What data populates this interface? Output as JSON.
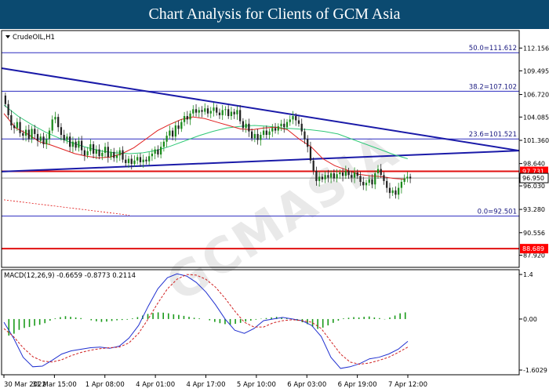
{
  "header": {
    "title": "Chart Analysis for Clients of GCM Asia"
  },
  "watermark": "GCMASIA",
  "chart_data": [
    {
      "type": "candlestick",
      "symbol_label": "CrudeOIL,H1",
      "x_ticks": [
        "30 Mar 2022",
        "31 Mar 15:00",
        "1 Apr 08:00",
        "4 Apr 01:00",
        "4 Apr 17:00",
        "5 Apr 10:00",
        "6 Apr 03:00",
        "6 Apr 19:00",
        "7 Apr 12:00"
      ],
      "y_ticks": [
        "112.156",
        "109.495",
        "106.720",
        "104.085",
        "101.360",
        "98.640",
        "96.030",
        "93.280",
        "90.556",
        "87.920"
      ],
      "ylim": [
        86.5,
        114.2
      ],
      "grid": false,
      "fib_levels": [
        {
          "label": "50.0=111.612",
          "value": 111.612
        },
        {
          "label": "38.2=107.102",
          "value": 107.102
        },
        {
          "label": "23.6=101.521",
          "value": 101.521
        },
        {
          "label": "0.0=92.501",
          "value": 92.501
        }
      ],
      "price_tags": [
        {
          "label": "97.731",
          "value": 97.731,
          "color": "#ff0000"
        },
        {
          "label": "96.950",
          "value": 96.95,
          "color": "#000000"
        },
        {
          "label": "88.689",
          "value": 88.689,
          "color": "#ff0000"
        }
      ],
      "horizontal_red_lines": [
        97.731,
        88.689
      ],
      "trendlines": [
        {
          "name": "descending resistance",
          "from": [
            0,
            109.8
          ],
          "to": [
            165,
            100.15
          ]
        },
        {
          "name": "ascending support",
          "from": [
            0,
            97.7
          ],
          "to": [
            165,
            100.15
          ]
        }
      ],
      "close": [
        105.6,
        104.3,
        103.1,
        102.8,
        103.5,
        102.2,
        101.9,
        102.6,
        101.5,
        102.7,
        102.1,
        101.3,
        101.8,
        100.9,
        101.5,
        102.5,
        103.8,
        104.1,
        102.9,
        102.0,
        101.4,
        101.8,
        100.6,
        101.2,
        100.5,
        101.3,
        100.2,
        99.6,
        100.1,
        100.9,
        99.8,
        100.3,
        99.5,
        99.9,
        100.6,
        99.4,
        100.0,
        99.3,
        99.6,
        100.2,
        99.1,
        98.7,
        99.2,
        98.6,
        99.0,
        99.4,
        98.8,
        99.1,
        98.9,
        99.5,
        99.8,
        100.3,
        99.7,
        100.6,
        101.2,
        101.9,
        102.5,
        101.8,
        103.1,
        102.7,
        103.5,
        104.2,
        103.8,
        104.5,
        105.0,
        104.6,
        104.9,
        104.7,
        105.1,
        104.5,
        104.8,
        105.2,
        104.6,
        104.3,
        104.9,
        105.0,
        104.2,
        104.7,
        104.4,
        104.9,
        103.6,
        102.8,
        103.3,
        102.4,
        101.6,
        102.1,
        101.4,
        102.0,
        102.5,
        102.0,
        102.4,
        102.8,
        102.5,
        103.0,
        103.3,
        102.9,
        103.5,
        103.8,
        104.2,
        103.7,
        103.3,
        102.4,
        101.5,
        100.6,
        99.0,
        97.8,
        96.6,
        97.1,
        96.8,
        97.3,
        97.0,
        97.5,
        96.9,
        97.4,
        97.6,
        97.2,
        97.8,
        97.3,
        97.0,
        97.6,
        97.2,
        96.5,
        96.1,
        96.4,
        96.8,
        96.2,
        97.5,
        98.0,
        97.3,
        96.6,
        95.8,
        95.2,
        95.5,
        95.0,
        95.8,
        96.5,
        96.9,
        97.1,
        96.9
      ],
      "ma_red_values": [
        104.5,
        102.8,
        102.1,
        101.2,
        100.8,
        100.3,
        99.8,
        99.5,
        99.3,
        99.4,
        99.8,
        100.5,
        101.5,
        102.5,
        103.2,
        103.8,
        104.1,
        103.9,
        103.5,
        103.1,
        102.7,
        102.6,
        102.8,
        102.9,
        102.6,
        101.5,
        100.6,
        99.2,
        98.4,
        97.9,
        97.4,
        97.2,
        97.1,
        96.9,
        96.8
      ],
      "ma_green_values": [
        105.5,
        104.2,
        103.2,
        102.3,
        101.6,
        101.0,
        100.5,
        100.1,
        99.9,
        99.8,
        99.9,
        100.2,
        100.7,
        101.3,
        101.9,
        102.4,
        102.8,
        103.0,
        103.1,
        103.0,
        102.8,
        102.7,
        102.6,
        102.4,
        102.1,
        101.5,
        100.9,
        100.3,
        99.7,
        99.2
      ],
      "ma_colors": {
        "red": "#e02020",
        "green": "#30c878"
      },
      "trendline_color": "#1a1aa8",
      "fib_color": "#2b2bc0",
      "candle_up_color": "#1a8a1a",
      "candle_down_color": "#222222"
    },
    {
      "type": "macd",
      "indicator_label": "MACD(12,26,9) -0.6659 -0.8773 0.2114",
      "y_ticks": [
        "1.4",
        "0.00",
        "-1.6029"
      ],
      "ylim": [
        -1.75,
        1.55
      ],
      "histogram": [
        -0.52,
        -0.46,
        -0.34,
        -0.28,
        -0.25,
        -0.21,
        -0.18,
        -0.13,
        -0.05,
        0.02,
        0.06,
        0.09,
        0.07,
        0.05,
        0.03,
        0.0,
        -0.04,
        -0.07,
        -0.09,
        -0.08,
        -0.06,
        -0.04,
        -0.03,
        -0.02,
        0.02,
        0.06,
        0.11,
        0.16,
        0.19,
        0.21,
        0.2,
        0.18,
        0.15,
        0.13,
        0.1,
        0.07,
        0.04,
        0.02,
        0.0,
        -0.04,
        -0.09,
        -0.13,
        -0.16,
        -0.18,
        -0.15,
        -0.12,
        -0.08,
        -0.05,
        -0.02,
        0.01,
        0.03,
        0.05,
        0.07,
        0.06,
        0.03,
        -0.01,
        -0.05,
        -0.1,
        -0.16,
        -0.24,
        -0.31,
        -0.27,
        -0.2,
        -0.12,
        -0.05,
        0.02,
        0.04,
        0.06,
        0.05,
        0.07,
        0.08,
        0.05,
        0.03,
        -0.01,
        0.05,
        0.11,
        0.18,
        0.21
      ],
      "macd_line": [
        -0.1,
        -0.6,
        -1.2,
        -1.5,
        -1.48,
        -1.3,
        -1.1,
        -1.0,
        -0.95,
        -0.9,
        -0.88,
        -0.92,
        -0.85,
        -0.6,
        -0.2,
        0.4,
        0.95,
        1.3,
        1.42,
        1.35,
        1.15,
        0.85,
        0.45,
        0.0,
        -0.35,
        -0.45,
        -0.3,
        -0.05,
        0.0,
        0.05,
        0.0,
        -0.05,
        -0.2,
        -0.55,
        -1.2,
        -1.55,
        -1.5,
        -1.4,
        -1.25,
        -1.2,
        -1.1,
        -0.95,
        -0.7
      ],
      "signal_line": [
        -0.3,
        -0.55,
        -0.9,
        -1.18,
        -1.32,
        -1.35,
        -1.28,
        -1.15,
        -1.05,
        -0.98,
        -0.93,
        -0.9,
        -0.88,
        -0.75,
        -0.45,
        0.0,
        0.5,
        0.95,
        1.25,
        1.4,
        1.38,
        1.25,
        1.0,
        0.65,
        0.25,
        -0.1,
        -0.25,
        -0.25,
        -0.12,
        -0.05,
        -0.02,
        -0.05,
        -0.1,
        -0.3,
        -0.7,
        -1.1,
        -1.35,
        -1.42,
        -1.38,
        -1.3,
        -1.2,
        -1.05,
        -0.88
      ],
      "colors": {
        "macd": "#2030d0",
        "signal": "#d02020",
        "histogram": "#1a9a1a"
      }
    }
  ]
}
